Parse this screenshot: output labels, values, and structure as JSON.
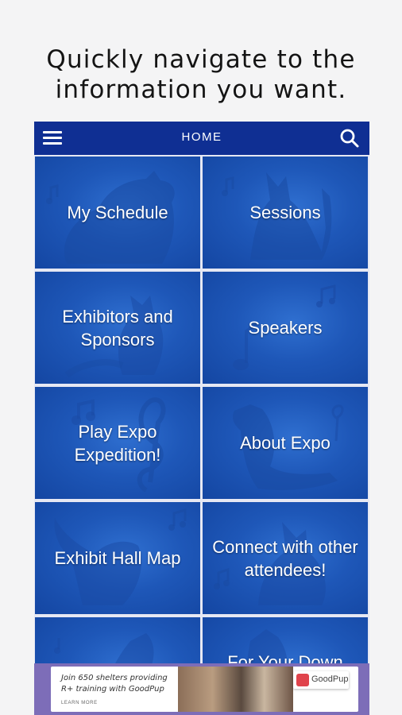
{
  "caption": {
    "line1": "Quickly navigate to the",
    "line2": "information you want."
  },
  "topbar": {
    "title": "HOME",
    "menu_icon": "hamburger-menu-icon",
    "search_icon": "search-icon"
  },
  "tiles": [
    {
      "line1": "My Schedule",
      "line2": ""
    },
    {
      "line1": "Sessions",
      "line2": ""
    },
    {
      "line1": "Exhibitors and",
      "line2": "Sponsors"
    },
    {
      "line1": "Speakers",
      "line2": ""
    },
    {
      "line1": "Play Expo",
      "line2": "Expedition!"
    },
    {
      "line1": "About Expo",
      "line2": ""
    },
    {
      "line1": "Exhibit Hall Map",
      "line2": ""
    },
    {
      "line1": "Connect with other",
      "line2": "attendees!"
    },
    {
      "line1": "",
      "line2": ""
    },
    {
      "line1": "For Your Down",
      "line2": ""
    }
  ],
  "ad": {
    "text_line1": "Join 650 shelters providing",
    "text_line2": "R+ training with GoodPup",
    "cta": "LEARN MORE",
    "brand": "GoodPup"
  },
  "colors": {
    "topbar": "#0f2f93",
    "tile": "#1e57b8",
    "ad_background": "#7d6db8"
  }
}
